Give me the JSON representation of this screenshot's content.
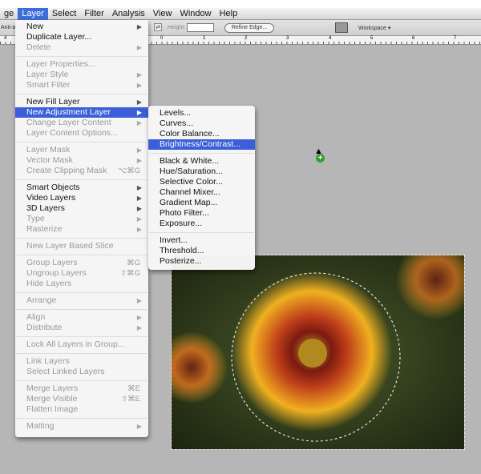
{
  "menubar": [
    "ge",
    "Layer",
    "Select",
    "Filter",
    "Analysis",
    "View",
    "Window",
    "Help"
  ],
  "active_menu": "Layer",
  "options": {
    "antialias": "Anti-a",
    "height_label": "Height:",
    "refine_edge": "Refine Edge...",
    "workspace": "Workspace ▾"
  },
  "ruler": [
    "4",
    "0",
    "1",
    "2",
    "3",
    "4",
    "5",
    "6",
    "7"
  ],
  "layer_menu": [
    {
      "label": "New",
      "arrow": true
    },
    {
      "label": "Duplicate Layer..."
    },
    {
      "label": "Delete",
      "arrow": true,
      "disabled": true
    },
    {
      "sep": true
    },
    {
      "label": "Layer Properties...",
      "disabled": true
    },
    {
      "label": "Layer Style",
      "arrow": true,
      "disabled": true
    },
    {
      "label": "Smart Filter",
      "arrow": true,
      "disabled": true
    },
    {
      "sep": true
    },
    {
      "label": "New Fill Layer",
      "arrow": true
    },
    {
      "label": "New Adjustment Layer",
      "arrow": true,
      "highlighted": true
    },
    {
      "label": "Change Layer Content",
      "arrow": true,
      "disabled": true
    },
    {
      "label": "Layer Content Options...",
      "disabled": true
    },
    {
      "sep": true
    },
    {
      "label": "Layer Mask",
      "arrow": true,
      "disabled": true
    },
    {
      "label": "Vector Mask",
      "arrow": true,
      "disabled": true
    },
    {
      "label": "Create Clipping Mask",
      "shortcut": "⌥⌘G",
      "disabled": true
    },
    {
      "sep": true
    },
    {
      "label": "Smart Objects",
      "arrow": true
    },
    {
      "label": "Video Layers",
      "arrow": true
    },
    {
      "label": "3D Layers",
      "arrow": true
    },
    {
      "label": "Type",
      "arrow": true,
      "disabled": true
    },
    {
      "label": "Rasterize",
      "arrow": true,
      "disabled": true
    },
    {
      "sep": true
    },
    {
      "label": "New Layer Based Slice",
      "disabled": true
    },
    {
      "sep": true
    },
    {
      "label": "Group Layers",
      "shortcut": "⌘G",
      "disabled": true
    },
    {
      "label": "Ungroup Layers",
      "shortcut": "⇧⌘G",
      "disabled": true
    },
    {
      "label": "Hide Layers",
      "disabled": true
    },
    {
      "sep": true
    },
    {
      "label": "Arrange",
      "arrow": true,
      "disabled": true
    },
    {
      "sep": true
    },
    {
      "label": "Align",
      "arrow": true,
      "disabled": true
    },
    {
      "label": "Distribute",
      "arrow": true,
      "disabled": true
    },
    {
      "sep": true
    },
    {
      "label": "Lock All Layers in Group...",
      "disabled": true
    },
    {
      "sep": true
    },
    {
      "label": "Link Layers",
      "disabled": true
    },
    {
      "label": "Select Linked Layers",
      "disabled": true
    },
    {
      "sep": true
    },
    {
      "label": "Merge Layers",
      "shortcut": "⌘E",
      "disabled": true
    },
    {
      "label": "Merge Visible",
      "shortcut": "⇧⌘E",
      "disabled": true
    },
    {
      "label": "Flatten Image",
      "disabled": true
    },
    {
      "sep": true
    },
    {
      "label": "Matting",
      "arrow": true,
      "disabled": true
    }
  ],
  "adjustment_submenu": [
    {
      "label": "Levels..."
    },
    {
      "label": "Curves..."
    },
    {
      "label": "Color Balance..."
    },
    {
      "label": "Brightness/Contrast...",
      "highlighted": true
    },
    {
      "sep": true
    },
    {
      "label": "Black & White..."
    },
    {
      "label": "Hue/Saturation..."
    },
    {
      "label": "Selective Color..."
    },
    {
      "label": "Channel Mixer..."
    },
    {
      "label": "Gradient Map..."
    },
    {
      "label": "Photo Filter..."
    },
    {
      "label": "Exposure..."
    },
    {
      "sep": true
    },
    {
      "label": "Invert..."
    },
    {
      "label": "Threshold..."
    },
    {
      "label": "Posterize..."
    }
  ],
  "colors": {
    "highlight": "#3b5fd8",
    "canvas": "#b6b6b6"
  }
}
